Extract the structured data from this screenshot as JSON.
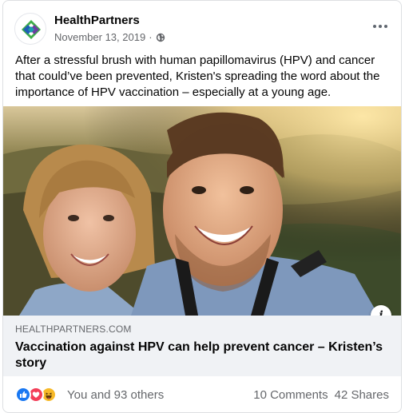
{
  "post": {
    "page_name": "HealthPartners",
    "date": "November 13, 2019",
    "separator": "·",
    "privacy_icon": "globe-icon",
    "more_icon": "more-options-icon",
    "text": "After a stressful brush with human papillomavirus (HPV) and cancer that could’ve been prevented, Kristen's spreading the word about the importance of HPV vaccination – especially at a young age."
  },
  "link": {
    "domain": "HEALTHPARTNERS.COM",
    "title": "Vaccination against HPV can help prevent cancer – Kristen’s story",
    "info_label": "i"
  },
  "engagement": {
    "reaction_icons": [
      "like-icon",
      "love-icon",
      "haha-icon"
    ],
    "reactions_text": "You and 93 others",
    "comments": "10 Comments",
    "shares": "42 Shares"
  },
  "colors": {
    "like": "#1877f2",
    "love": "#f33e58",
    "haha": "#f7b928",
    "logo_green": "#3fae49",
    "logo_blue": "#1f5eb5",
    "logo_purple": "#6b3fa0"
  }
}
